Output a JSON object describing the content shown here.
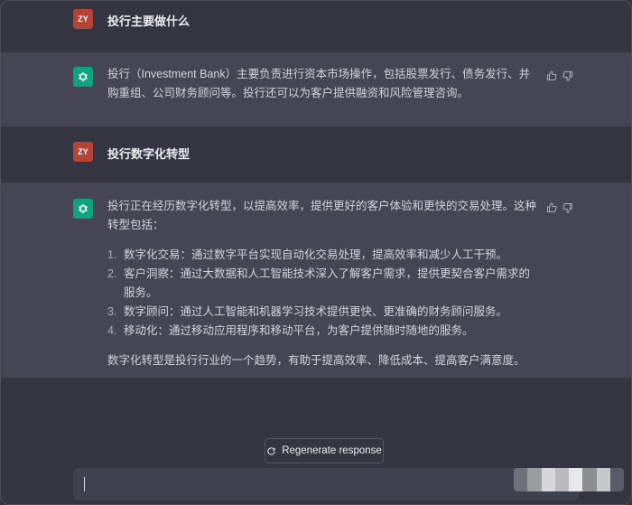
{
  "conversation": [
    {
      "role": "user",
      "avatar": "ZY",
      "text": "投行主要做什么"
    },
    {
      "role": "assistant",
      "text": "投行（Investment Bank）主要负责进行资本市场操作，包括股票发行、债务发行、并购重组、公司财务顾问等。投行还可以为客户提供融资和风险管理咨询。"
    },
    {
      "role": "user",
      "avatar": "ZY",
      "text": "投行数字化转型"
    },
    {
      "role": "assistant",
      "intro": "投行正在经历数字化转型，以提高效率，提供更好的客户体验和更快的交易处理。这种转型包括：",
      "items": [
        {
          "num": "1.",
          "text": "数字化交易：通过数字平台实现自动化交易处理，提高效率和减少人工干预。"
        },
        {
          "num": "2.",
          "text": "客户洞察：通过大数据和人工智能技术深入了解客户需求，提供更契合客户需求的服务。"
        },
        {
          "num": "3.",
          "text": "数字顾问：通过人工智能和机器学习技术提供更快、更准确的财务顾问服务。"
        },
        {
          "num": "4.",
          "text": "移动化：通过移动应用程序和移动平台，为客户提供随时随地的服务。"
        }
      ],
      "outro": "数字化转型是投行行业的一个趋势，有助于提高效率、降低成本、提高客户满意度。"
    }
  ],
  "regenerate_label": "Regenerate response",
  "icons": {
    "bot": "chatgpt-logo-icon",
    "like": "thumbs-up-icon",
    "dislike": "thumbs-down-icon",
    "regen": "refresh-icon"
  },
  "colors": {
    "user_avatar": "#b64338",
    "bot_avatar": "#10a37f",
    "user_bg": "#343541",
    "bot_bg": "#444654"
  }
}
